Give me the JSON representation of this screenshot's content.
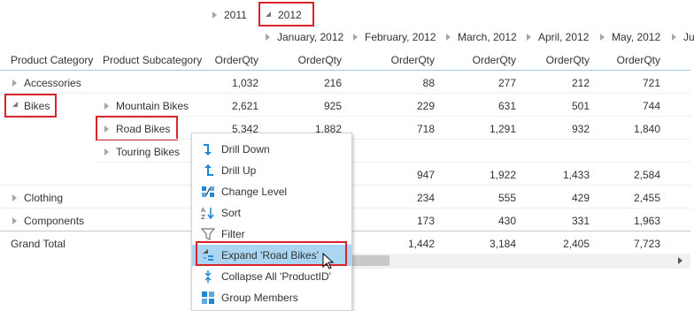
{
  "years": [
    "2011",
    "2012"
  ],
  "months": [
    "January, 2012",
    "February, 2012",
    "March, 2012",
    "April, 2012",
    "May, 2012",
    "Ju"
  ],
  "headers": {
    "category": "Product Category",
    "subcategory": "Product Subcategory",
    "measure": "OrderQty"
  },
  "rows": [
    {
      "category": "Accessories",
      "subcategory": "",
      "values": [
        "1,032",
        "216",
        "88",
        "277",
        "212",
        "721"
      ]
    },
    {
      "category": "Bikes",
      "subcategory": "Mountain Bikes",
      "values": [
        "2,621",
        "925",
        "229",
        "631",
        "501",
        "744"
      ]
    },
    {
      "category": "",
      "subcategory": "Road Bikes",
      "values": [
        "5,342",
        "1,882",
        "718",
        "1,291",
        "932",
        "1,840"
      ]
    },
    {
      "category": "",
      "subcategory": "Touring Bikes",
      "values": [
        "",
        "",
        "",
        "",
        "",
        ""
      ]
    },
    {
      "category": "",
      "subcategory": "",
      "values": [
        "",
        "",
        "947",
        "1,922",
        "1,433",
        "2,584"
      ]
    },
    {
      "category": "Clothing",
      "subcategory": "",
      "values": [
        "",
        "",
        "234",
        "555",
        "429",
        "2,455"
      ]
    },
    {
      "category": "Components",
      "subcategory": "",
      "values": [
        "",
        "",
        "173",
        "430",
        "331",
        "1,963"
      ]
    },
    {
      "category": "Grand Total",
      "subcategory": "",
      "values": [
        "",
        "",
        "1,442",
        "3,184",
        "2,405",
        "7,723"
      ]
    }
  ],
  "menu": [
    {
      "label": "Drill Down",
      "icon": "drill-down-icon"
    },
    {
      "label": "Drill Up",
      "icon": "drill-up-icon"
    },
    {
      "label": "Change Level",
      "icon": "change-level-icon"
    },
    {
      "label": "Sort",
      "icon": "sort-icon"
    },
    {
      "label": "Filter",
      "icon": "filter-icon"
    },
    {
      "label": "Expand 'Road Bikes'",
      "icon": "expand-icon"
    },
    {
      "label": "Collapse All 'ProductID'",
      "icon": "collapse-all-icon"
    },
    {
      "label": "Group Members",
      "icon": "group-members-icon"
    }
  ],
  "colors": {
    "highlight": "#d9252a",
    "menu_hover": "#aad6f3",
    "icon_blue": "#1e88d6",
    "header_line": "#9fc9e8"
  }
}
